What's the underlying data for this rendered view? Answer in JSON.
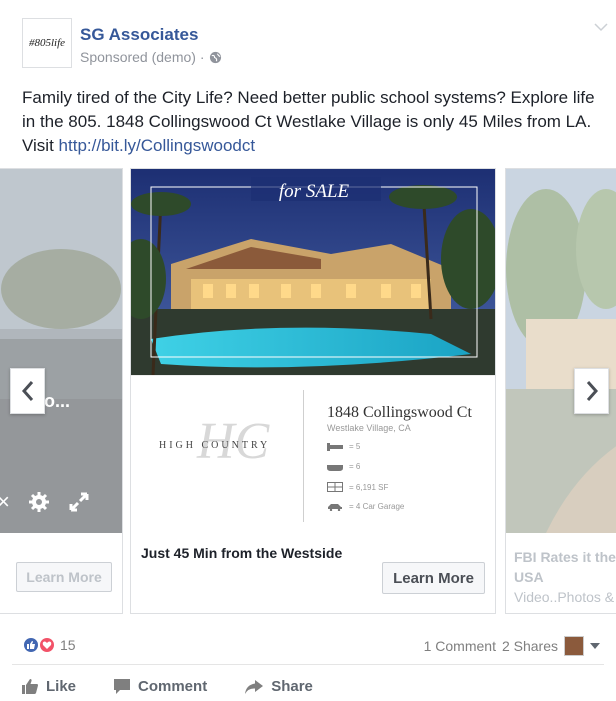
{
  "header": {
    "logo_text": "#805life",
    "page_name": "SG Associates",
    "sponsored": "Sponsored (demo) ·"
  },
  "post": {
    "text": "Family tired of the City Life? Need better public school systems? Explore life in the 805. 1848 Collingswood Ct Westlake Village is only 45 Miles from LA. Visit ",
    "link": "http://bit.ly/Collingswoodct"
  },
  "carousel": {
    "left_card": {
      "title": "voo...",
      "cta": "Learn More"
    },
    "main_card": {
      "overlay": "for SALE",
      "brand": "HIGH COUNTRY",
      "monogram": "HC",
      "address": "1848 Collingswood Ct",
      "city": "Westlake Village, CA",
      "specs": [
        "= 5",
        "= 6",
        "= 6,191 SF",
        "= 4 Car Garage"
      ],
      "caption": "Just 45 Min from the Westside",
      "cta": "Learn More"
    },
    "right_card": {
      "caption_line1": "FBI Rates it the",
      "caption_line2": "USA",
      "caption_line3": "Video..Photos &"
    }
  },
  "footer": {
    "reaction_count": "15",
    "comments": "1 Comment",
    "shares": "2 Shares",
    "like": "Like",
    "comment": "Comment",
    "share": "Share"
  },
  "colors": {
    "link": "#365899",
    "like_blue": "#4267b2",
    "love_red": "#f25268",
    "muted": "#90949c"
  }
}
